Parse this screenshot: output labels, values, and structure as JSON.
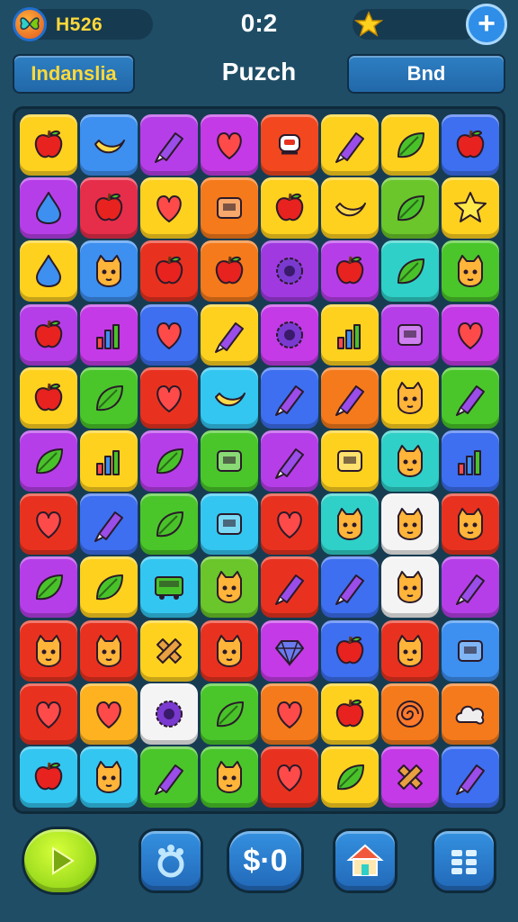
{
  "hud": {
    "score": "H526",
    "timer": "0:2",
    "icons": {
      "logo": "butterfly-logo-icon",
      "star": "star-icon",
      "add": "plus-icon"
    }
  },
  "header": {
    "left_button": "Indanslia",
    "title": "Puzch",
    "right_button": "Bnd"
  },
  "board": {
    "rows": [
      [
        {
          "color": "#ffd11f",
          "icon": "apple-icon"
        },
        {
          "color": "#3d8ff0",
          "icon": "banana-icon"
        },
        {
          "color": "#b63ee8",
          "icon": "crayon-icon"
        },
        {
          "color": "#c43ae6",
          "icon": "heart-icon"
        },
        {
          "color": "#f2471f",
          "icon": "bell-icon"
        },
        {
          "color": "#ffd11f",
          "icon": "crayon-icon"
        },
        {
          "color": "#ffd11f",
          "icon": "leaf-icon"
        },
        {
          "color": "#3d6ff0",
          "icon": "apple-icon"
        }
      ],
      [
        {
          "color": "#b63ee8",
          "icon": "drop-icon"
        },
        {
          "color": "#e62e4a",
          "icon": "apple-icon"
        },
        {
          "color": "#ffd11f",
          "icon": "heart-icon"
        },
        {
          "color": "#f57a1b",
          "icon": "box-icon"
        },
        {
          "color": "#ffd11f",
          "icon": "apple-icon"
        },
        {
          "color": "#ffd11f",
          "icon": "banana-icon"
        },
        {
          "color": "#6ac62a",
          "icon": "leaf-icon"
        },
        {
          "color": "#ffd11f",
          "icon": "star-icon"
        }
      ],
      [
        {
          "color": "#ffd11f",
          "icon": "drop-icon"
        },
        {
          "color": "#3d8ff0",
          "icon": "cat-icon"
        },
        {
          "color": "#e8321f",
          "icon": "apple-icon"
        },
        {
          "color": "#f57a1b",
          "icon": "apple-icon"
        },
        {
          "color": "#a03ae0",
          "icon": "gear-icon"
        },
        {
          "color": "#b63ee8",
          "icon": "apple-icon"
        },
        {
          "color": "#2fd0c8",
          "icon": "leaf-icon"
        },
        {
          "color": "#4ac62a",
          "icon": "cat-icon"
        }
      ],
      [
        {
          "color": "#b63ee8",
          "icon": "apple-icon"
        },
        {
          "color": "#c43ae6",
          "icon": "chart-icon"
        },
        {
          "color": "#3d6ff0",
          "icon": "heart-icon"
        },
        {
          "color": "#ffd11f",
          "icon": "crayon-icon"
        },
        {
          "color": "#c43ae6",
          "icon": "gear-icon"
        },
        {
          "color": "#ffd11f",
          "icon": "chart-icon"
        },
        {
          "color": "#b63ee8",
          "icon": "box-icon"
        },
        {
          "color": "#c43ae6",
          "icon": "heart-icon"
        }
      ],
      [
        {
          "color": "#ffd11f",
          "icon": "apple-icon"
        },
        {
          "color": "#4ac62a",
          "icon": "leaf-icon"
        },
        {
          "color": "#e8321f",
          "icon": "heart-icon"
        },
        {
          "color": "#33c6f0",
          "icon": "banana-icon"
        },
        {
          "color": "#3d6ff0",
          "icon": "crayon-icon"
        },
        {
          "color": "#f57a1b",
          "icon": "crayon-icon"
        },
        {
          "color": "#ffd11f",
          "icon": "cat-icon"
        },
        {
          "color": "#4ac62a",
          "icon": "crayon-icon"
        }
      ],
      [
        {
          "color": "#b63ee8",
          "icon": "leaf-icon"
        },
        {
          "color": "#ffd11f",
          "icon": "chart-icon"
        },
        {
          "color": "#b63ee8",
          "icon": "leaf-icon"
        },
        {
          "color": "#4ac62a",
          "icon": "box-icon"
        },
        {
          "color": "#b63ee8",
          "icon": "crayon-icon"
        },
        {
          "color": "#ffd11f",
          "icon": "box-icon"
        },
        {
          "color": "#2fd0c8",
          "icon": "cat-icon"
        },
        {
          "color": "#3d6ff0",
          "icon": "chart-icon"
        }
      ],
      [
        {
          "color": "#e8321f",
          "icon": "heart-icon"
        },
        {
          "color": "#3d6ff0",
          "icon": "crayon-icon"
        },
        {
          "color": "#4ac62a",
          "icon": "leaf-icon"
        },
        {
          "color": "#33c6f0",
          "icon": "box-icon"
        },
        {
          "color": "#e8321f",
          "icon": "heart-icon"
        },
        {
          "color": "#2fd0c8",
          "icon": "cat-icon"
        },
        {
          "color": "#f4f4f4",
          "icon": "cat-icon"
        },
        {
          "color": "#e8321f",
          "icon": "cat-icon"
        }
      ],
      [
        {
          "color": "#b63ee8",
          "icon": "leaf-icon"
        },
        {
          "color": "#ffd11f",
          "icon": "leaf-icon"
        },
        {
          "color": "#33c6f0",
          "icon": "bus-icon"
        },
        {
          "color": "#6ac62a",
          "icon": "cat-icon"
        },
        {
          "color": "#e8321f",
          "icon": "crayon-icon"
        },
        {
          "color": "#3d6ff0",
          "icon": "crayon-icon"
        },
        {
          "color": "#f4f4f4",
          "icon": "cat-icon"
        },
        {
          "color": "#b63ee8",
          "icon": "crayon-icon"
        }
      ],
      [
        {
          "color": "#e8321f",
          "icon": "cat-icon"
        },
        {
          "color": "#e8321f",
          "icon": "cat-icon"
        },
        {
          "color": "#ffd11f",
          "icon": "cross-icon"
        },
        {
          "color": "#e8321f",
          "icon": "cat-icon"
        },
        {
          "color": "#c43ae6",
          "icon": "gem-icon"
        },
        {
          "color": "#3d6ff0",
          "icon": "apple-icon"
        },
        {
          "color": "#e8321f",
          "icon": "cat-icon"
        },
        {
          "color": "#3d8ff0",
          "icon": "box-icon"
        }
      ],
      [
        {
          "color": "#e8321f",
          "icon": "heart-icon"
        },
        {
          "color": "#ffb21f",
          "icon": "heart-icon"
        },
        {
          "color": "#f4f4f4",
          "icon": "gear-icon"
        },
        {
          "color": "#4ac62a",
          "icon": "leaf-icon"
        },
        {
          "color": "#f57a1b",
          "icon": "heart-icon"
        },
        {
          "color": "#ffd11f",
          "icon": "apple-icon"
        },
        {
          "color": "#f57a1b",
          "icon": "swirl-icon"
        },
        {
          "color": "#f57a1b",
          "icon": "cloud-icon"
        }
      ],
      [
        {
          "color": "#33c6f0",
          "icon": "apple-icon"
        },
        {
          "color": "#33c6f0",
          "icon": "cat-icon"
        },
        {
          "color": "#4ac62a",
          "icon": "crayon-icon"
        },
        {
          "color": "#4ac62a",
          "icon": "cat-icon"
        },
        {
          "color": "#e8321f",
          "icon": "heart-icon"
        },
        {
          "color": "#ffd11f",
          "icon": "leaf-icon"
        },
        {
          "color": "#c43ae6",
          "icon": "cross-icon"
        },
        {
          "color": "#3d6ff0",
          "icon": "crayon-icon"
        }
      ]
    ]
  },
  "bottom": {
    "coin_label": "$·0",
    "icons": [
      "play-icon",
      "paw-icon",
      "coin-icon",
      "home-icon",
      "grid-icon"
    ]
  }
}
